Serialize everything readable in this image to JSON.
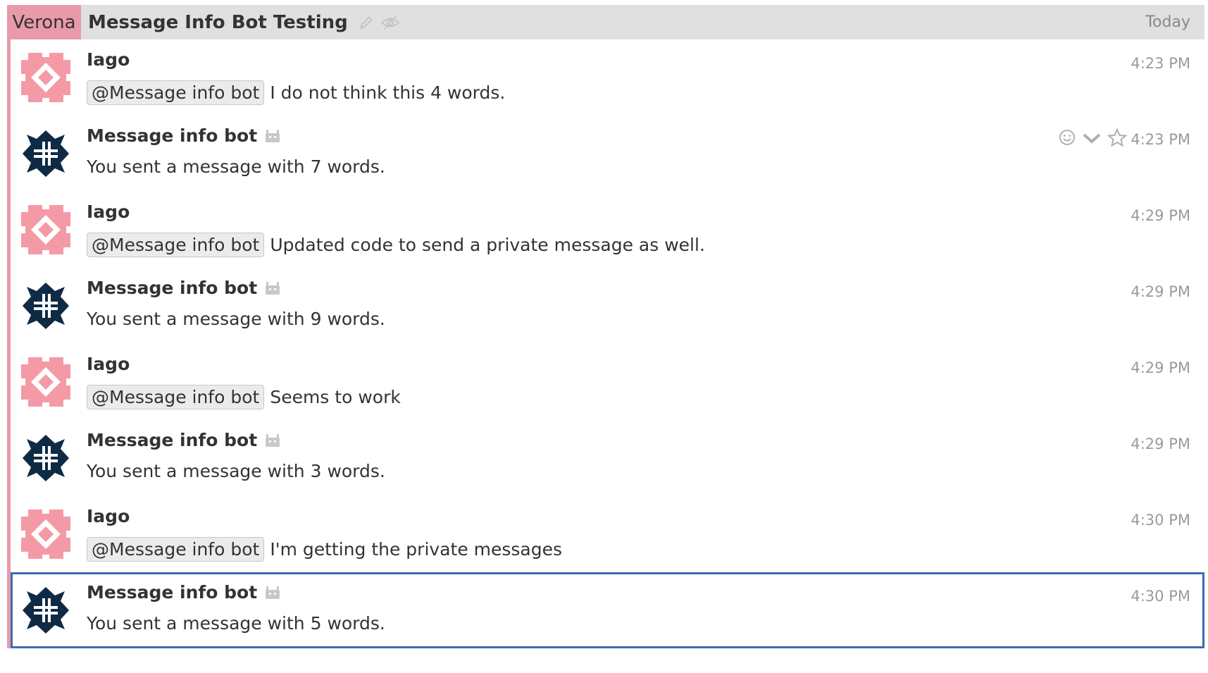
{
  "header": {
    "stream": "Verona",
    "topic": "Message Info Bot Testing",
    "date": "Today",
    "stream_color": "#e89aa9",
    "header_bg": "#e0e0e0"
  },
  "messages": [
    {
      "sender": "Iago",
      "is_bot": false,
      "mention": "@Message info bot",
      "text": "I do not think this 4 words.",
      "time": "4:23 PM"
    },
    {
      "sender": "Message info bot",
      "is_bot": true,
      "mention": "",
      "text": "You sent a message with 7 words.",
      "time": "4:23 PM",
      "hovered": true
    },
    {
      "sender": "Iago",
      "is_bot": false,
      "mention": "@Message info bot",
      "text": "Updated code to send a private message as well.",
      "time": "4:29 PM"
    },
    {
      "sender": "Message info bot",
      "is_bot": true,
      "mention": "",
      "text": "You sent a message with 9 words.",
      "time": "4:29 PM"
    },
    {
      "sender": "Iago",
      "is_bot": false,
      "mention": "@Message info bot",
      "text": "Seems to work",
      "time": "4:29 PM"
    },
    {
      "sender": "Message info bot",
      "is_bot": true,
      "mention": "",
      "text": "You sent a message with 3 words.",
      "time": "4:29 PM"
    },
    {
      "sender": "Iago",
      "is_bot": false,
      "mention": "@Message info bot",
      "text": "I'm getting the private messages",
      "time": "4:30 PM"
    },
    {
      "sender": "Message info bot",
      "is_bot": true,
      "mention": "",
      "text": "You sent a message with 5 words.",
      "time": "4:30 PM",
      "selected": true
    }
  ],
  "icons": {
    "edit_topic": "pencil-icon",
    "mute_topic": "eye-slash-icon",
    "bot_badge": "robot-icon",
    "emoji_reaction": "smiley-icon",
    "message_actions": "chevron-down-icon",
    "star": "star-icon"
  },
  "colors": {
    "human_avatar": "#f49aa6",
    "bot_avatar": "#0f2a45",
    "selected_border": "#3a6db3"
  }
}
